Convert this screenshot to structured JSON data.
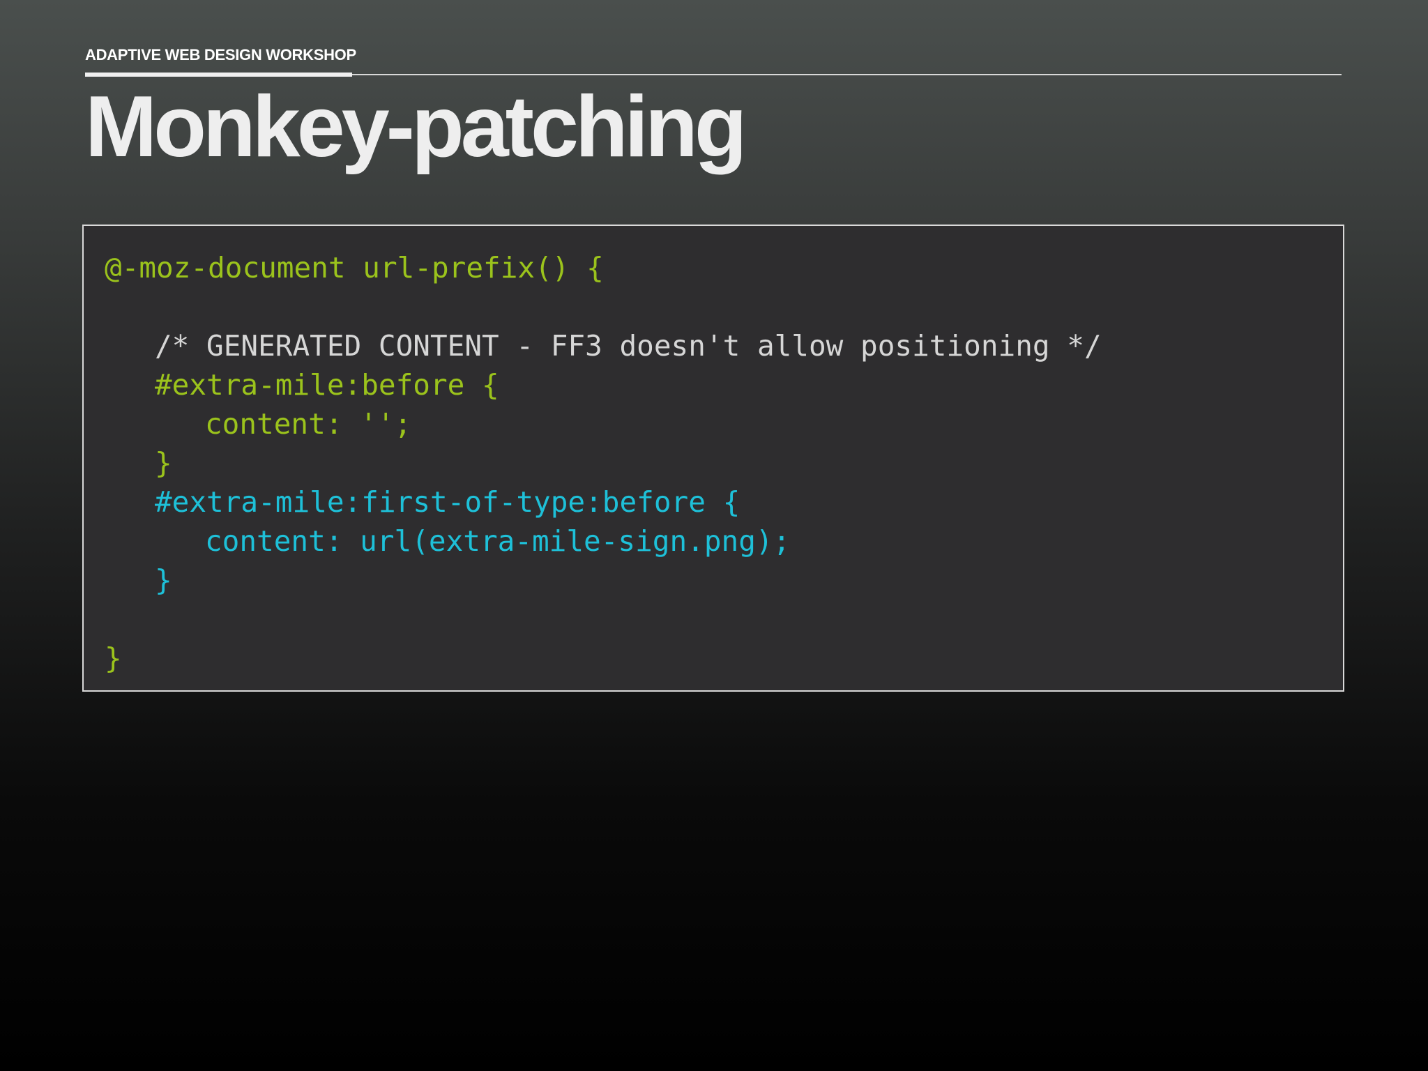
{
  "header": {
    "workshop_label": "ADAPTIVE WEB DESIGN WORKSHOP"
  },
  "slide": {
    "title": "Monkey-patching"
  },
  "code": {
    "lines": [
      "@-moz-document url-prefix() {",
      "/* GENERATED CONTENT - FF3 doesn't allow positioning */",
      "#extra-mile:before {",
      "content: '';",
      "}",
      "#extra-mile:first-of-type:before {",
      "content: url(extra-mile-sign.png);",
      "}",
      "}"
    ]
  },
  "colors": {
    "code_green": "#9bc31c",
    "code_cyan": "#1ec0d8",
    "code_comment": "#d6d6d6",
    "code_background": "#2e2d2f"
  }
}
